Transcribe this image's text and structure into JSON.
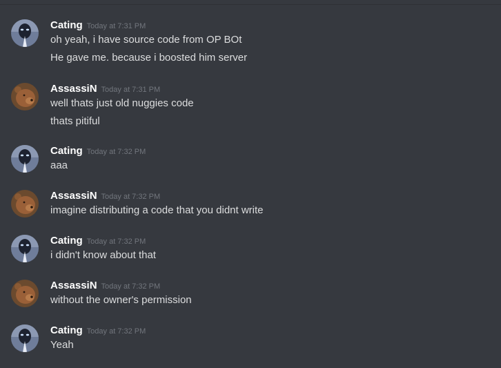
{
  "messages": [
    {
      "author": "Cating",
      "avatar_icon": "alien-keyhole-avatar-icon",
      "timestamp": "Today at 7:31 PM",
      "lines": [
        "oh yeah, i have source code from OP BOt",
        "He gave me. because i boosted him server"
      ]
    },
    {
      "author": "AssassiN",
      "avatar_icon": "bear-avatar-icon",
      "timestamp": "Today at 7:31 PM",
      "lines": [
        "well thats just old nuggies code",
        "thats pitiful"
      ]
    },
    {
      "author": "Cating",
      "avatar_icon": "alien-keyhole-avatar-icon",
      "timestamp": "Today at 7:32 PM",
      "lines": [
        "aaa"
      ]
    },
    {
      "author": "AssassiN",
      "avatar_icon": "bear-avatar-icon",
      "timestamp": "Today at 7:32 PM",
      "lines": [
        "imagine distributing a code that you didnt write"
      ]
    },
    {
      "author": "Cating",
      "avatar_icon": "alien-keyhole-avatar-icon",
      "timestamp": "Today at 7:32 PM",
      "lines": [
        "i didn't know about that"
      ]
    },
    {
      "author": "AssassiN",
      "avatar_icon": "bear-avatar-icon",
      "timestamp": "Today at 7:32 PM",
      "lines": [
        "without the owner's permission"
      ]
    },
    {
      "author": "Cating",
      "avatar_icon": "alien-keyhole-avatar-icon",
      "timestamp": "Today at 7:32 PM",
      "lines": [
        "Yeah"
      ]
    }
  ]
}
